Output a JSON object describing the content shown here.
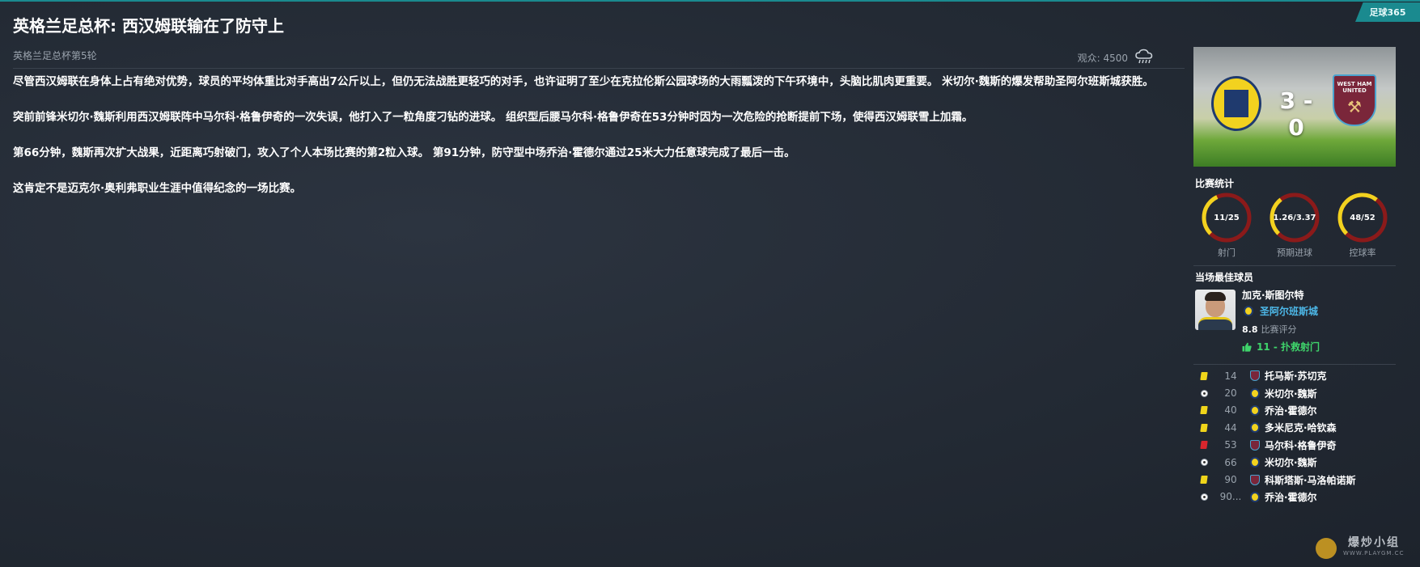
{
  "source_tag": "足球365",
  "headline": "英格兰足总杯: 西汉姆联输在了防守上",
  "competition": "英格兰足总杯第5轮",
  "attendance_label": "观众: 4500",
  "weather_icon": "rain-cloud-icon",
  "article": [
    "尽管西汉姆联在身体上占有绝对优势，球员的平均体重比对手高出7公斤以上，但仍无法战胜更轻巧的对手，也许证明了至少在克拉伦斯公园球场的大雨瓢泼的下午环境中，头脑比肌肉更重要。 米切尔·魏斯的爆发帮助圣阿尔班斯城获胜。",
    "突前前锋米切尔·魏斯利用西汉姆联阵中马尔科·格鲁伊奇的一次失误，他打入了一粒角度刁钻的进球。 组织型后腰马尔科·格鲁伊奇在53分钟时因为一次危险的抢断提前下场，使得西汉姆联雪上加霜。",
    "第66分钟，魏斯再次扩大战果，近距离巧射破门，攻入了个人本场比赛的第2粒入球。 第91分钟，防守型中场乔治·霍德尔通过25米大力任意球完成了最后一击。",
    "这肯定不是迈克尔·奥利弗职业生涯中值得纪念的一场比赛。"
  ],
  "match": {
    "score": "3 - 0",
    "home_badge": "st-albans-city-badge",
    "away_badge": "west-ham-united-badge",
    "away_badge_text": "WEST HAM UNITED"
  },
  "stats": {
    "title": "比赛统计",
    "items": [
      {
        "value": "11/25",
        "label": "射门",
        "home_fraction": 0.306
      },
      {
        "value": "1.26/3.37",
        "label": "预期进球",
        "home_fraction": 0.272
      },
      {
        "value": "48/52",
        "label": "控球率",
        "home_fraction": 0.48
      }
    ],
    "home_color": "#f2d21f",
    "away_color": "#8b1a1a"
  },
  "potm": {
    "title": "当场最佳球员",
    "name": "加克·斯图尔特",
    "club": "圣阿尔班斯城",
    "rating": "8.8",
    "rating_label": "比赛评分",
    "highlight": "11 - 扑救射门"
  },
  "events": [
    {
      "type": "yellow",
      "minute": "14",
      "team": "away",
      "player": "托马斯·苏切克"
    },
    {
      "type": "goal",
      "minute": "20",
      "team": "home",
      "player": "米切尔·魏斯"
    },
    {
      "type": "yellow",
      "minute": "40",
      "team": "home",
      "player": "乔治·霍德尔"
    },
    {
      "type": "yellow",
      "minute": "44",
      "team": "home",
      "player": "多米尼克·哈钦森"
    },
    {
      "type": "red",
      "minute": "53",
      "team": "away",
      "player": "马尔科·格鲁伊奇"
    },
    {
      "type": "goal",
      "minute": "66",
      "team": "home",
      "player": "米切尔·魏斯"
    },
    {
      "type": "yellow",
      "minute": "90",
      "team": "away",
      "player": "科斯塔斯·马洛帕诺斯"
    },
    {
      "type": "goal",
      "minute": "90...",
      "team": "home",
      "player": "乔治·霍德尔"
    }
  ],
  "watermark": "爆炒小组",
  "watermark_sub": "WWW.PLAYGM.CC"
}
